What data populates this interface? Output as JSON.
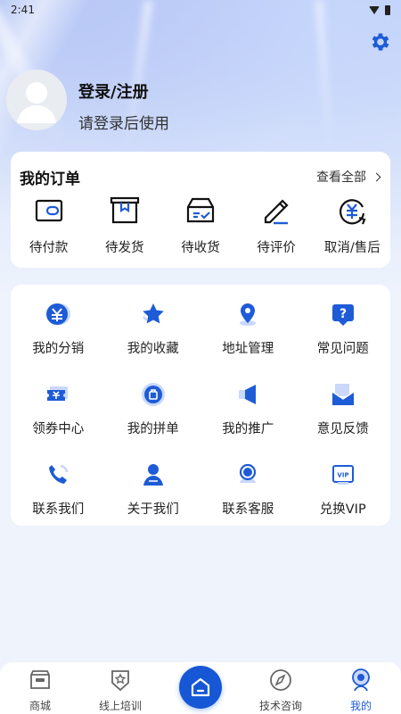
{
  "status_bar": {
    "time": "2:41"
  },
  "profile": {
    "title": "登录/注册",
    "subtitle": "请登录后使用"
  },
  "orders": {
    "title": "我的订单",
    "view_all": "查看全部",
    "items": [
      {
        "label": "待付款",
        "icon": "wallet-icon"
      },
      {
        "label": "待发货",
        "icon": "box-icon"
      },
      {
        "label": "待收货",
        "icon": "delivery-box-icon"
      },
      {
        "label": "待评价",
        "icon": "pen-icon"
      },
      {
        "label": "取消/售后",
        "icon": "refund-icon"
      }
    ]
  },
  "services": {
    "items": [
      {
        "label": "我的分销",
        "icon": "yuan-coin-icon"
      },
      {
        "label": "我的收藏",
        "icon": "star-icon"
      },
      {
        "label": "地址管理",
        "icon": "location-pin-icon"
      },
      {
        "label": "常见问题",
        "icon": "question-icon"
      },
      {
        "label": "领券中心",
        "icon": "coupon-icon"
      },
      {
        "label": "我的拼单",
        "icon": "shopping-bag-icon"
      },
      {
        "label": "我的推广",
        "icon": "megaphone-icon"
      },
      {
        "label": "意见反馈",
        "icon": "mail-icon"
      },
      {
        "label": "联系我们",
        "icon": "phone-icon"
      },
      {
        "label": "关于我们",
        "icon": "person-icon"
      },
      {
        "label": "联系客服",
        "icon": "customer-service-icon"
      },
      {
        "label": "兑换VIP",
        "icon": "vip-icon"
      }
    ]
  },
  "tabbar": {
    "items": [
      {
        "label": "商城",
        "icon": "shop-icon"
      },
      {
        "label": "线上培训",
        "icon": "badge-star-icon"
      },
      {
        "label": "",
        "icon": "home-icon"
      },
      {
        "label": "技术咨询",
        "icon": "compass-icon"
      },
      {
        "label": "我的",
        "icon": "profile-icon",
        "active": true
      }
    ]
  },
  "colors": {
    "accent": "#1557d4",
    "icon_blue": "#1e5bd6"
  }
}
